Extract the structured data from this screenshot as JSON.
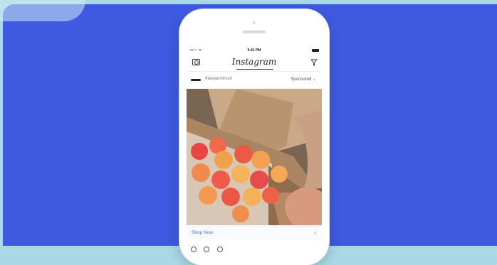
{
  "status_bar": {
    "signal": "•••○○ ᯤ",
    "time": "9:41 PM"
  },
  "navbar": {
    "logo": "Instagram"
  },
  "post": {
    "username": "thepeachtruck",
    "sponsored_label": "Sponsored ⌄",
    "cta_label": "Shop Now",
    "cta_chevron": "›"
  },
  "colors": {
    "background": "#3f5ae0",
    "link": "#3b6ee8"
  },
  "icons": [
    "camera-icon",
    "direct-message-icon",
    "chevron-right-icon",
    "like-icon",
    "comment-icon",
    "share-icon"
  ]
}
